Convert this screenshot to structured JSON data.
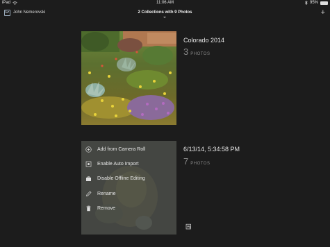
{
  "status": {
    "device": "iPad",
    "time": "11:06 AM",
    "battery": "95%",
    "battery_level": 0.95
  },
  "nav": {
    "app_badge": "Lr",
    "user": "John Nemerovski",
    "title": "2 Collections with 9 Photos",
    "add": "+"
  },
  "collections": [
    {
      "name": "Colorado 2014",
      "count": "3",
      "unit": "PHOTOS"
    },
    {
      "name": "6/13/14, 5:34:58 PM",
      "count": "7",
      "unit": "PHOTOS"
    }
  ],
  "menu": {
    "items": [
      {
        "label": "Add from Camera Roll",
        "icon": "add-circle-icon"
      },
      {
        "label": "Enable Auto Import",
        "icon": "auto-import-icon"
      },
      {
        "label": "Disable Offline Editing",
        "icon": "offline-icon"
      },
      {
        "label": "Rename",
        "icon": "pencil-icon"
      },
      {
        "label": "Remove",
        "icon": "trash-icon"
      }
    ]
  },
  "colors": {
    "background": "#1c1c1c",
    "menu_overlay": "#46484466"
  }
}
